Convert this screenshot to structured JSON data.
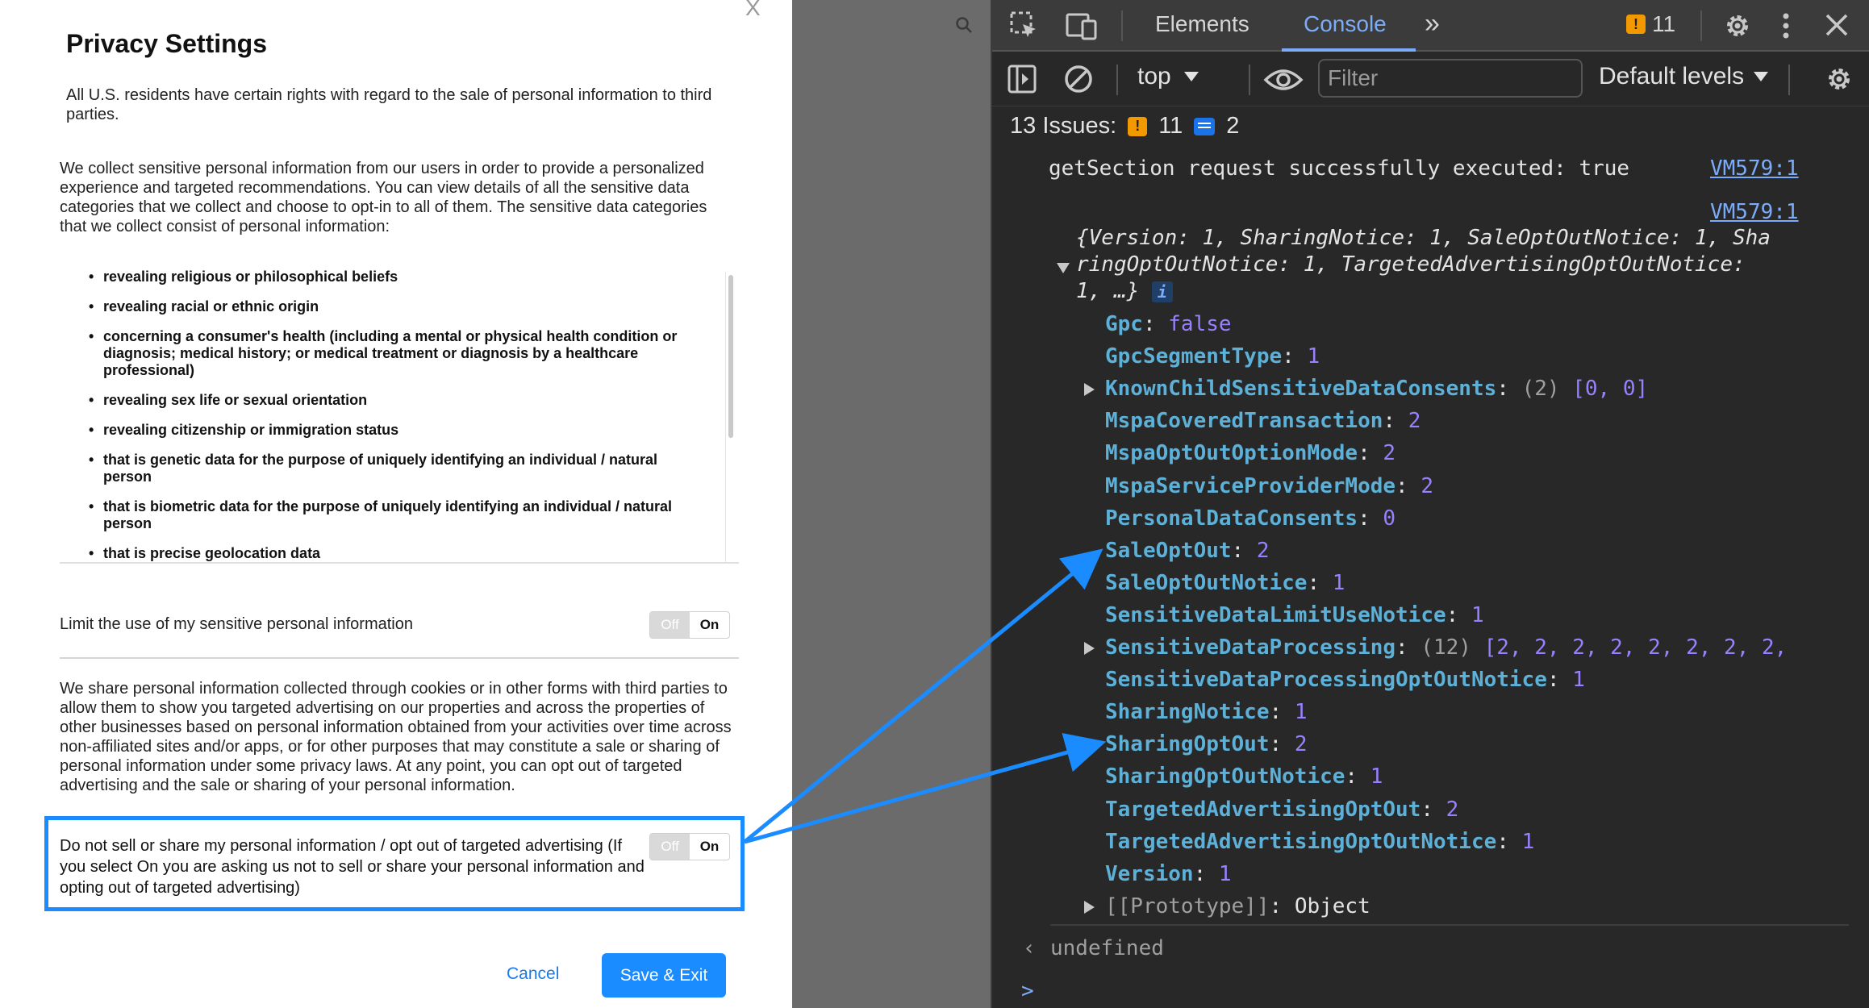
{
  "dialog": {
    "close_label": "X",
    "title": "Privacy Settings",
    "intro": "All U.S. residents have certain rights with regard to the sale of personal information to third parties.",
    "collect_text": "We collect sensitive personal information from our users in order to provide a personalized experience and targeted recommendations. You can view details of all the sensitive data categories that we collect and choose to opt-in to all of them. The sensitive data categories that we collect consist of personal information:",
    "categories": [
      "revealing religious or philosophical beliefs",
      "revealing racial or ethnic origin",
      "concerning a consumer's health (including a mental or physical health condition or diagnosis; medical history; or medical treatment or diagnosis by a healthcare professional)",
      "revealing sex life or sexual orientation",
      "revealing citizenship or immigration status",
      "that is genetic data for the purpose of uniquely identifying an individual / natural person",
      "that is biometric data for the purpose of uniquely identifying an individual / natural person",
      "that is precise geolocation data"
    ],
    "limit_label": "Limit the use of my sensitive personal information",
    "share_text": "We share personal information collected through cookies or in other forms with third parties to allow them to show you targeted advertising on our properties and across the properties of other businesses based on personal information obtained from your activities over time across non-affiliated sites and/or apps, or for other purposes that may constitute a sale or sharing of personal information under some privacy laws. At any point, you can opt out of targeted advertising and the sale or sharing of your personal information.",
    "sell_label": "Do not sell or share my personal information / opt out of targeted advertising (If you select On you are asking us not to sell or share your personal information and opting out of targeted advertising)",
    "toggle_off": "Off",
    "toggle_on": "On",
    "limit_toggle_state": "On",
    "sell_toggle_state": "On",
    "cancel_label": "Cancel",
    "save_label": "Save & Exit"
  },
  "devtools": {
    "tabs": [
      "Elements",
      "Console"
    ],
    "active_tab": "Console",
    "more_tabs": "»",
    "warning_count": "11",
    "context": "top",
    "filter_placeholder": "Filter",
    "levels_label": "Default levels",
    "issues_label": "13 Issues:",
    "issues_warnings": "11",
    "issues_info": "2",
    "console": {
      "log_message": "getSection request successfully executed: true",
      "source1": "VM579:1",
      "source2": "VM579:1",
      "object_preview_line1": "{Version: 1, SharingNotice: 1, SaleOptOutNotice: 1, Sha",
      "object_preview_line2": "ringOptOutNotice: 1, TargetedAdvertisingOptOutNotice:",
      "object_preview_line3": "1, …}",
      "info_badge": "i",
      "properties": [
        {
          "key": "Gpc",
          "value": "false",
          "type": "bool"
        },
        {
          "key": "GpcSegmentType",
          "value": "1",
          "type": "num"
        },
        {
          "key": "KnownChildSensitiveDataConsents",
          "value": "(2) [0, 0]",
          "type": "array"
        },
        {
          "key": "MspaCoveredTransaction",
          "value": "2",
          "type": "num"
        },
        {
          "key": "MspaOptOutOptionMode",
          "value": "2",
          "type": "num"
        },
        {
          "key": "MspaServiceProviderMode",
          "value": "2",
          "type": "num"
        },
        {
          "key": "PersonalDataConsents",
          "value": "0",
          "type": "num"
        },
        {
          "key": "SaleOptOut",
          "value": "2",
          "type": "num"
        },
        {
          "key": "SaleOptOutNotice",
          "value": "1",
          "type": "num"
        },
        {
          "key": "SensitiveDataLimitUseNotice",
          "value": "1",
          "type": "num"
        },
        {
          "key": "SensitiveDataProcessing",
          "value": "(12) [2, 2, 2, 2, 2, 2, 2, 2,",
          "type": "array"
        },
        {
          "key": "SensitiveDataProcessingOptOutNotice",
          "value": "1",
          "type": "num"
        },
        {
          "key": "SharingNotice",
          "value": "1",
          "type": "num"
        },
        {
          "key": "SharingOptOut",
          "value": "2",
          "type": "num"
        },
        {
          "key": "SharingOptOutNotice",
          "value": "1",
          "type": "num"
        },
        {
          "key": "TargetedAdvertisingOptOut",
          "value": "2",
          "type": "num"
        },
        {
          "key": "TargetedAdvertisingOptOutNotice",
          "value": "1",
          "type": "num"
        },
        {
          "key": "Version",
          "value": "1",
          "type": "num"
        },
        {
          "key": "[[Prototype]]",
          "value": "Object",
          "type": "proto"
        }
      ],
      "return_value": "undefined",
      "prompt": ">"
    }
  },
  "colors": {
    "highlight": "#1a8cff",
    "button": "#1a8cff",
    "console_key": "#5db0d7",
    "console_number": "#9980ff",
    "link": "#7cacf8"
  }
}
